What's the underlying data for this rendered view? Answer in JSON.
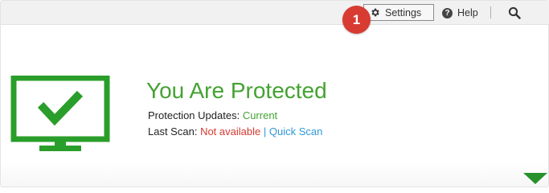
{
  "toolbar": {
    "badge_number": "1",
    "settings_label": "Settings",
    "help_label": "Help",
    "search_icon": "search-icon",
    "settings_icon": "gear-icon",
    "help_icon": "help-icon"
  },
  "status": {
    "headline": "You Are Protected",
    "updates_label": "Protection Updates:",
    "updates_value": "Current",
    "scan_label": "Last Scan:",
    "scan_value": "Not available",
    "divider": "|",
    "quick_scan_label": "Quick Scan",
    "monitor_icon": "monitor-check-icon"
  },
  "colors": {
    "protected_green": "#44a232",
    "warning_red": "#d43a2f",
    "link_blue": "#2f98d6",
    "badge_red": "#d83b31"
  }
}
